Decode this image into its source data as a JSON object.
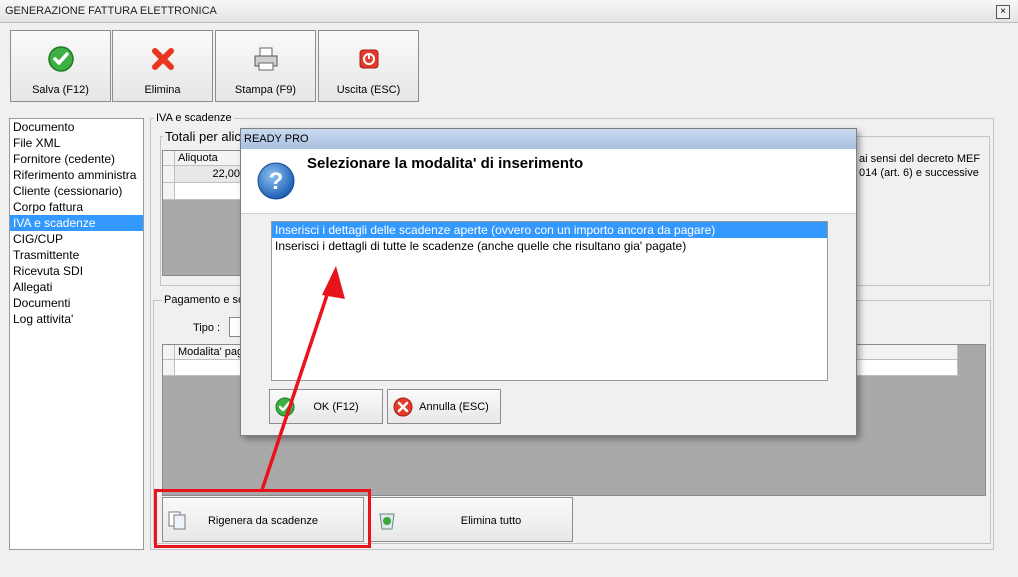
{
  "window": {
    "title": "GENERAZIONE FATTURA ELETTRONICA",
    "close": "×"
  },
  "toolbar": [
    {
      "label": "Salva (F12)",
      "icon": "check-icon"
    },
    {
      "label": "Elimina",
      "icon": "x-icon"
    },
    {
      "label": "Stampa (F9)",
      "icon": "printer-icon"
    },
    {
      "label": "Uscita (ESC)",
      "icon": "power-icon"
    }
  ],
  "nav": {
    "items": [
      "Documento",
      "File XML",
      "Fornitore (cedente)",
      "Riferimento amministra",
      "Cliente (cessionario)",
      "Corpo fattura",
      "IVA e scadenze",
      "CIG/CUP",
      "Trasmittente",
      "Ricevuta SDI",
      "Allegati",
      "Documenti",
      "Log attivita'"
    ],
    "selected_index": 6
  },
  "iva": {
    "group_title": "IVA e scadenze",
    "totals_title": "Totali per alic",
    "col_aliquota": "Aliquota",
    "row1_aliquota": "22,00",
    "note_line1": "ai sensi del decreto MEF",
    "note_line2": "014 (art. 6) e successive"
  },
  "pagamento": {
    "group_title": "Pagamento e sca",
    "tipo_label": "Tipo :",
    "col_modalita": "Modalita' pag"
  },
  "bottom_buttons": {
    "rigenera": "Rigenera da scadenze",
    "elimina_tutto": "Elimina tutto"
  },
  "dialog": {
    "title": "READY PRO",
    "question": "Selezionare la modalita' di inserimento",
    "options": [
      "Inserisci i dettagli delle scadenze aperte (ovvero con un importo ancora da pagare)",
      "Inserisci i dettagli di tutte le scadenze (anche quelle che risultano gia' pagate)"
    ],
    "selected_index": 0,
    "ok_label": "OK (F12)",
    "cancel_label": "Annulla (ESC)"
  },
  "colors": {
    "selection": "#3399ff",
    "annotation": "#e8141b"
  }
}
